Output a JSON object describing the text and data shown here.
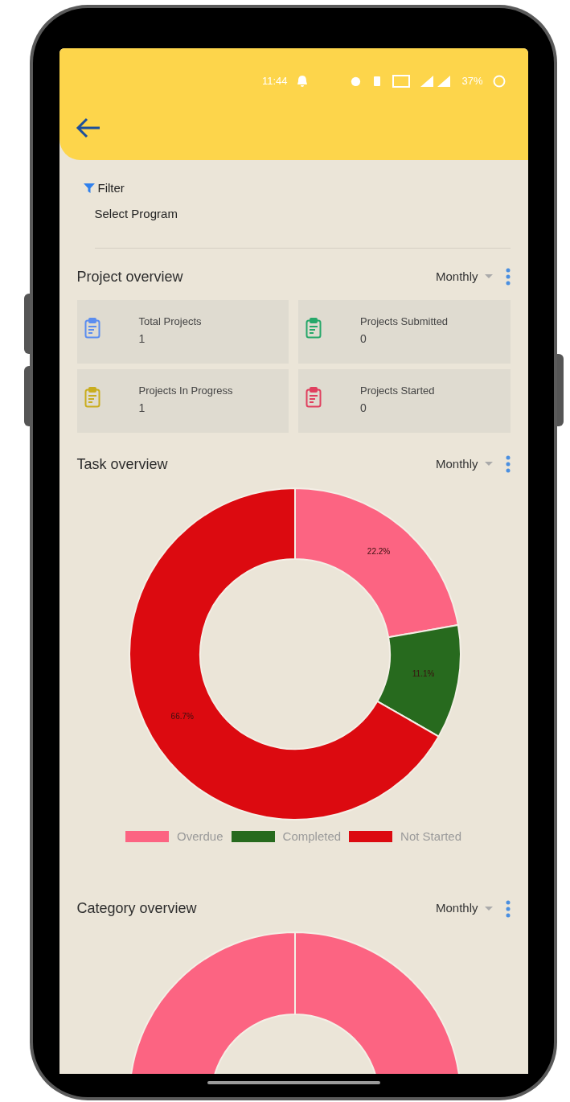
{
  "status_bar": {
    "time": "11:44",
    "battery": "37%"
  },
  "filter": {
    "label": "Filter",
    "placeholder": "Select Program"
  },
  "project_overview": {
    "title": "Project overview",
    "period": "Monthly",
    "cards": [
      {
        "label": "Total Projects",
        "value": "1",
        "color": "#5b8def"
      },
      {
        "label": "Projects Submitted",
        "value": "0",
        "color": "#27a86a"
      },
      {
        "label": "Projects In Progress",
        "value": "1",
        "color": "#c9ad1e"
      },
      {
        "label": "Projects Started",
        "value": "0",
        "color": "#e0405f"
      }
    ]
  },
  "task_overview": {
    "title": "Task overview",
    "period": "Monthly",
    "chart_data": {
      "type": "donut",
      "categories": [
        "Overdue",
        "Completed",
        "Not Started"
      ],
      "colors": [
        "#fc6482",
        "#276a1e",
        "#dc0a10"
      ],
      "values": [
        22.2,
        11.1,
        66.7
      ],
      "legend": true,
      "value_labels": [
        "22.2%",
        "11.1%",
        "66.7%"
      ]
    }
  },
  "category_overview": {
    "title": "Category overview",
    "period": "Monthly"
  }
}
